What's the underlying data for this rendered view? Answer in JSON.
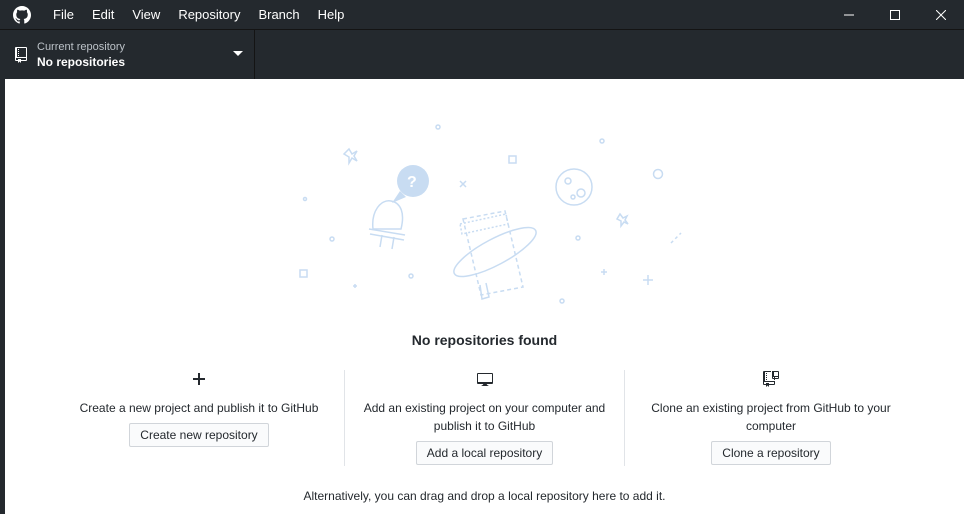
{
  "menu": {
    "file": "File",
    "edit": "Edit",
    "view": "View",
    "repository": "Repository",
    "branch": "Branch",
    "help": "Help"
  },
  "window_controls": [
    "minimize-icon",
    "maximize-icon",
    "close-icon"
  ],
  "toolbar": {
    "repo_label": "Current repository",
    "repo_value": "No repositories"
  },
  "blank_slate": {
    "title": "No repositories found",
    "actions": [
      {
        "icon": "plus-icon",
        "description": "Create a new project and publish it to GitHub",
        "button": "Create new repository"
      },
      {
        "icon": "desktop-icon",
        "description": "Add an existing project on your computer and publish it to GitHub",
        "button": "Add a local repository"
      },
      {
        "icon": "repo-clone-icon",
        "description": "Clone an existing project from GitHub to your computer",
        "button": "Clone a repository"
      }
    ],
    "footer": "Alternatively, you can drag and drop a local repository here to add it."
  },
  "colors": {
    "titlebar_bg": "#24292e",
    "illustration": "#c8dcf2",
    "button_border": "#d1d5da"
  }
}
